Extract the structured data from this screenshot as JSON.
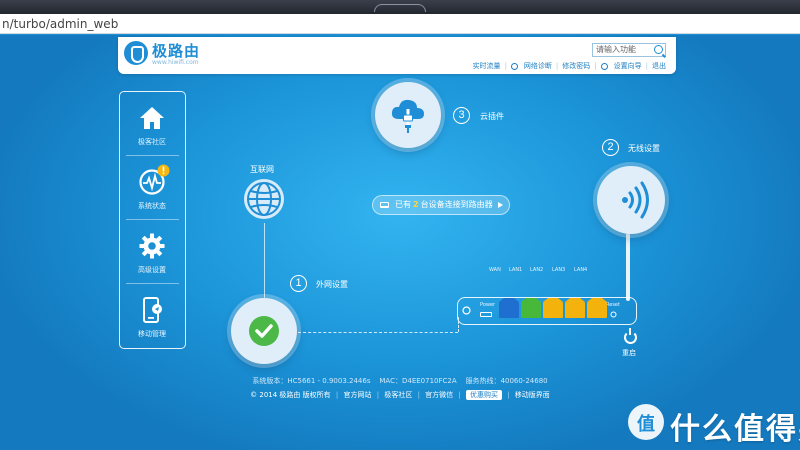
{
  "browser": {
    "address": "n/turbo/admin_web"
  },
  "header": {
    "brand": "极路由",
    "brand_url": "www.hiwifi.com",
    "search_placeholder": "请输入功能",
    "links": [
      "实时流量",
      "网络诊断",
      "修改密码",
      "设置向导",
      "退出"
    ]
  },
  "sidebar": {
    "items": [
      {
        "label": "极客社区",
        "icon": "home-icon"
      },
      {
        "label": "系统状态",
        "icon": "heartbeat-icon",
        "badge": "!"
      },
      {
        "label": "高级设置",
        "icon": "gear-icon"
      },
      {
        "label": "移动管理",
        "icon": "mobile-icon"
      }
    ]
  },
  "features": {
    "internet_label": "互联网",
    "wan_step": "1",
    "wan_label": "外网设置",
    "wifi_step": "2",
    "wifi_label": "无线设置",
    "cloud_step": "3",
    "cloud_label": "云插件"
  },
  "devices": {
    "prefix": "已有",
    "count": "2",
    "suffix": "台设备连接到路由器"
  },
  "router": {
    "ports": [
      "WAN",
      "LAN1",
      "LAN2",
      "LAN3",
      "LAN4"
    ],
    "power_label": "Power",
    "reset_label": "Reset",
    "reboot_label": "重启",
    "colors": {
      "wan": "#1f6fd0",
      "lan1": "#48b83a",
      "lan": "#f3b20c"
    }
  },
  "footer": {
    "version_label": "系统版本：",
    "version": "HC5661 - 0.9003.2446s",
    "mac_label": "MAC：",
    "mac": "D4EE0710FC2A",
    "hotline_label": "服务热线：",
    "hotline": "40060-24680",
    "copyright": "© 2014 极路由 版权所有",
    "links": [
      "官方网站",
      "极客社区",
      "官方微信"
    ],
    "promo": "优惠购买",
    "mobile_link": "移动版界面"
  },
  "watermark": {
    "badge": "值",
    "text": "什么值得买"
  }
}
